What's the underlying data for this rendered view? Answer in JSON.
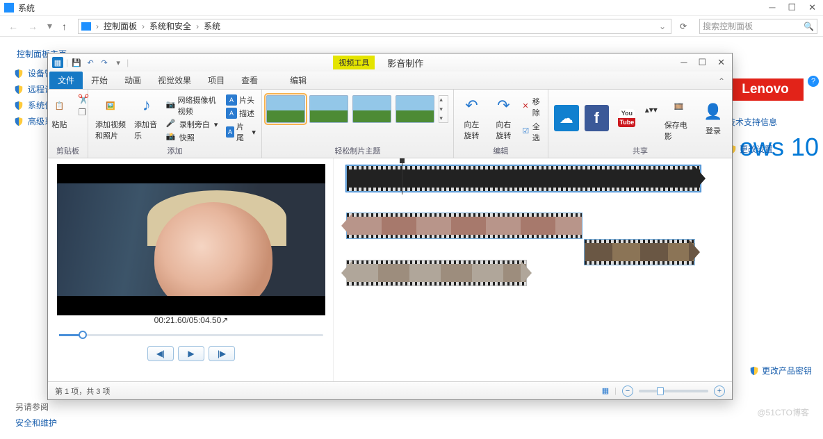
{
  "cp": {
    "title": "系统",
    "breadcrumb": [
      "控制面板",
      "系统和安全",
      "系统"
    ],
    "search_placeholder": "搜索控制面板",
    "left_header": "控制面板主页",
    "left_items": [
      "设备管理",
      "远程设置",
      "系统保护",
      "高级系统"
    ],
    "bottom_links": [
      "另请参阅",
      "安全和维护"
    ],
    "right": {
      "win10": "ows 10",
      "lenovo": "Lenovo",
      "links": [
        "技术支持信息",
        "更改设置"
      ],
      "change_key": "更改产品密钥"
    }
  },
  "mm": {
    "tool_tab": "视频工具",
    "app_title": "影音制作",
    "tabs": {
      "file": "文件",
      "list": [
        "开始",
        "动画",
        "视觉效果",
        "项目",
        "查看"
      ],
      "edit": "编辑"
    },
    "ribbon": {
      "clipboard": {
        "paste": "粘贴",
        "label": "剪贴板"
      },
      "add": {
        "vid_photo": "添加视频\n和照片",
        "music": "添加音乐",
        "webcam": "网络摄像机视频",
        "narration": "录制旁白",
        "snapshot": "快照",
        "title": "片头",
        "caption": "描述",
        "credit": "片尾",
        "label": "添加"
      },
      "themes": {
        "label": "轻松制片主题"
      },
      "edit": {
        "rotL": "向左\n旋转",
        "rotR": "向右\n旋转",
        "del": "移除",
        "all": "全选",
        "label": "编辑"
      },
      "share": {
        "save": "保存电影",
        "login": "登录",
        "label": "共享"
      }
    },
    "preview": {
      "time": "00:21.60/05:04.50"
    },
    "status": {
      "left": "第 1 项，共 3 项"
    }
  },
  "watermark": "@51CTO博客"
}
